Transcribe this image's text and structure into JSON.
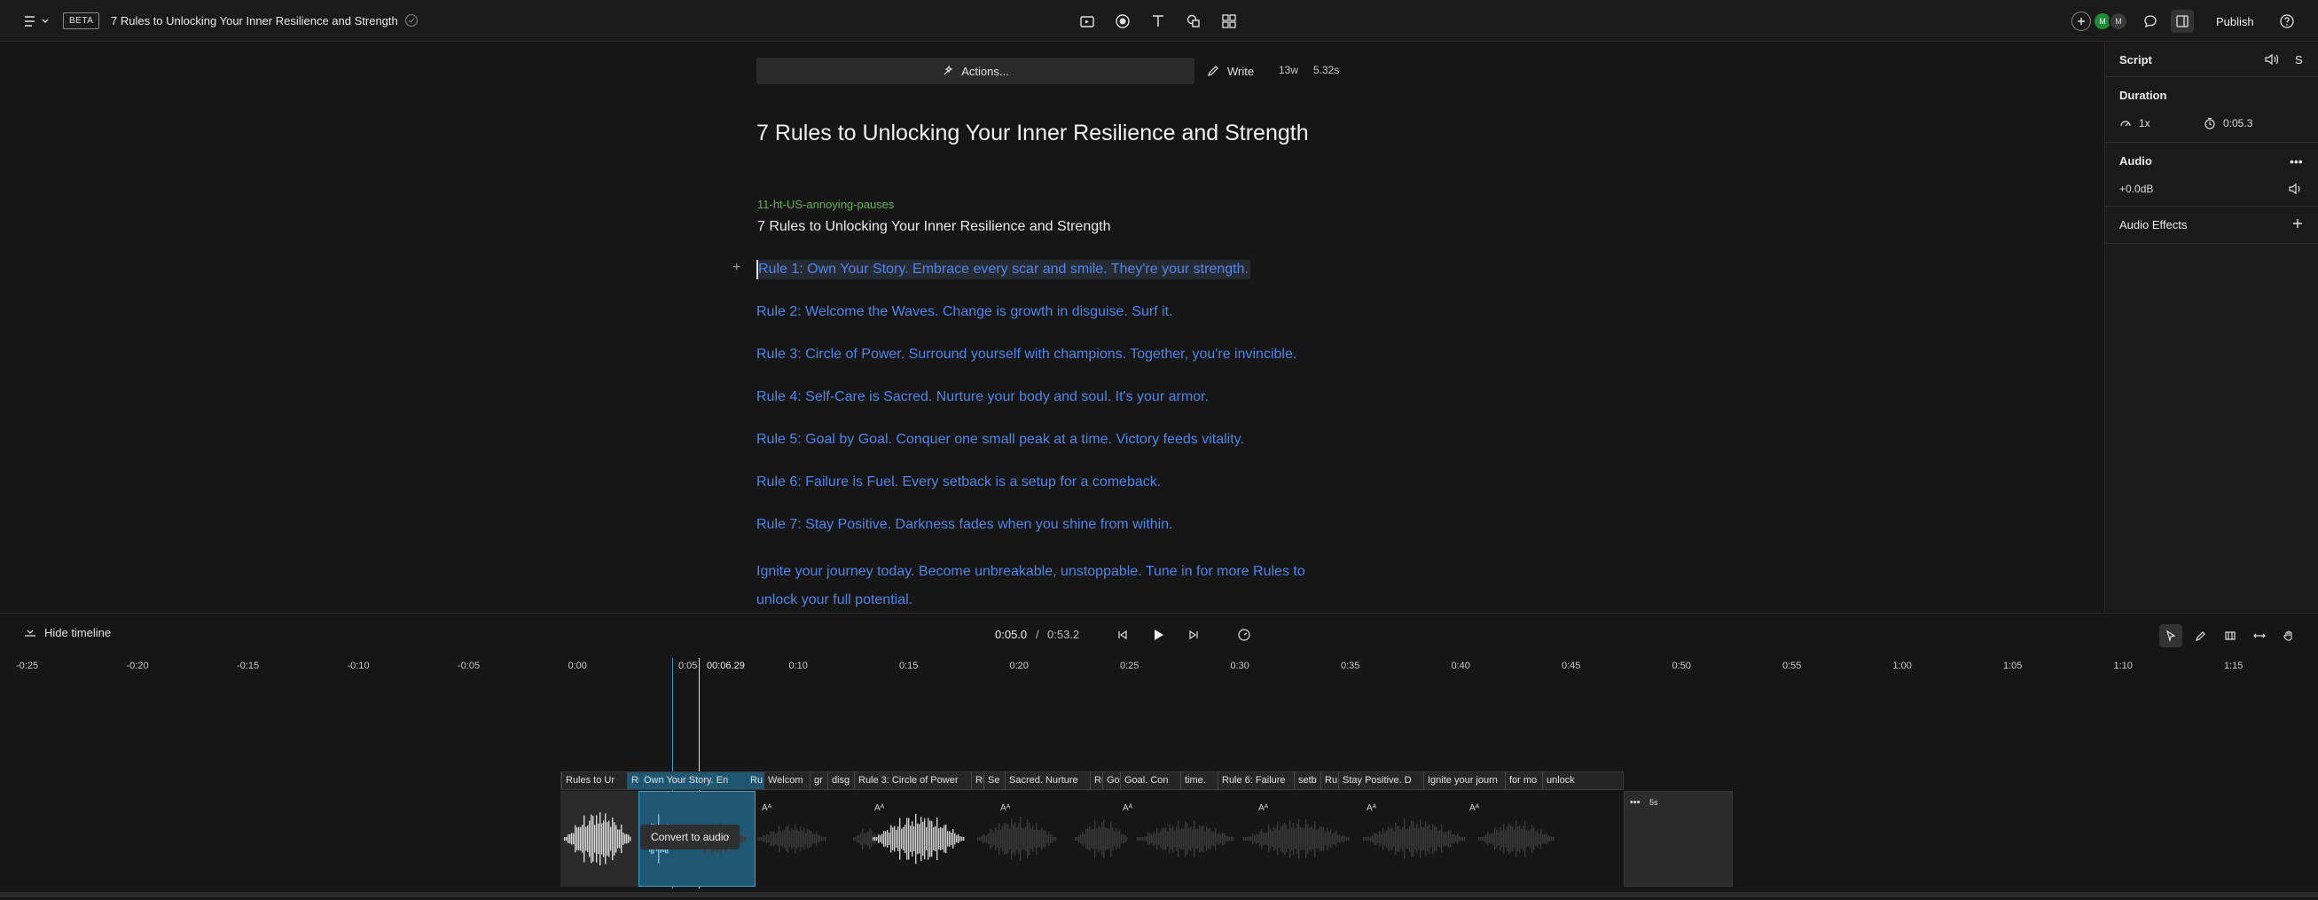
{
  "topbar": {
    "beta": "BETA",
    "title": "7 Rules to Unlocking Your Inner Resilience and Strength",
    "avatars": [
      "M",
      "M"
    ],
    "publish": "Publish"
  },
  "editor": {
    "actions": "Actions...",
    "write": "Write",
    "word_count": "13w",
    "duration": "5.32s",
    "heading": "7 Rules to Unlocking Your Inner Resilience and Strength",
    "speaker": "11-ht-US-annoying-pauses",
    "speaker_line": "7 Rules to Unlocking Your Inner Resilience and Strength",
    "rules": [
      "Rule 1: Own Your Story. Embrace every scar and smile. They're your strength.",
      "Rule 2: Welcome the Waves. Change is growth in disguise. Surf it.",
      "Rule 3: Circle of Power. Surround yourself with champions. Together, you're invincible.",
      "Rule 4: Self-Care is Sacred. Nurture your body and soul. It's your armor.",
      "Rule 5: Goal by Goal. Conquer one small peak at a time. Victory feeds vitality.",
      "Rule 6: Failure is Fuel. Every setback is a setup for a comeback.",
      "Rule 7: Stay Positive. Darkness fades when you shine from within."
    ],
    "closing_1": "Ignite your journey today. Become unbreakable, unstoppable. Tune in for more Rules to",
    "closing_2": "unlock your full potential."
  },
  "right_panel": {
    "tab_script": "Script",
    "tab_s": "S",
    "duration_title": "Duration",
    "speed": "1x",
    "time": "0:05.3",
    "audio_title": "Audio",
    "gain": "+0.0dB",
    "effects_title": "Audio Effects"
  },
  "timeline": {
    "hide": "Hide timeline",
    "current": "0:05.0",
    "sep": "/",
    "total": "0:53.2",
    "playhead": "00:06.29",
    "ticks": [
      "-0:25",
      "-0:20",
      "-0:15",
      "-0:10",
      "-0:05",
      "0:00",
      "0:05",
      "0:10",
      "0:15",
      "0:20",
      "0:25",
      "0:30",
      "0:35",
      "0:40",
      "0:45",
      "0:50",
      "0:55",
      "1:00",
      "1:05",
      "1:10",
      "1:15"
    ],
    "clip_labels": [
      "Rules to Ur",
      "Ru",
      "Own Your Story. En",
      "Ru",
      "Welcom",
      "gr",
      "disg",
      "Rule 3: Circle of Power",
      "Ru",
      "Se",
      "Sacred. Nurture",
      "Ru",
      "Go",
      "Goal. Con",
      "time.",
      "Rule 6: Failure",
      "setb",
      "Ru",
      "Stay Positive. D",
      "Ignite your journ",
      "for mo",
      "unlock"
    ],
    "convert": "Convert to audio",
    "aa_glyph": "Aᴬ",
    "end_label": "5s",
    "end_dots": "•••"
  }
}
